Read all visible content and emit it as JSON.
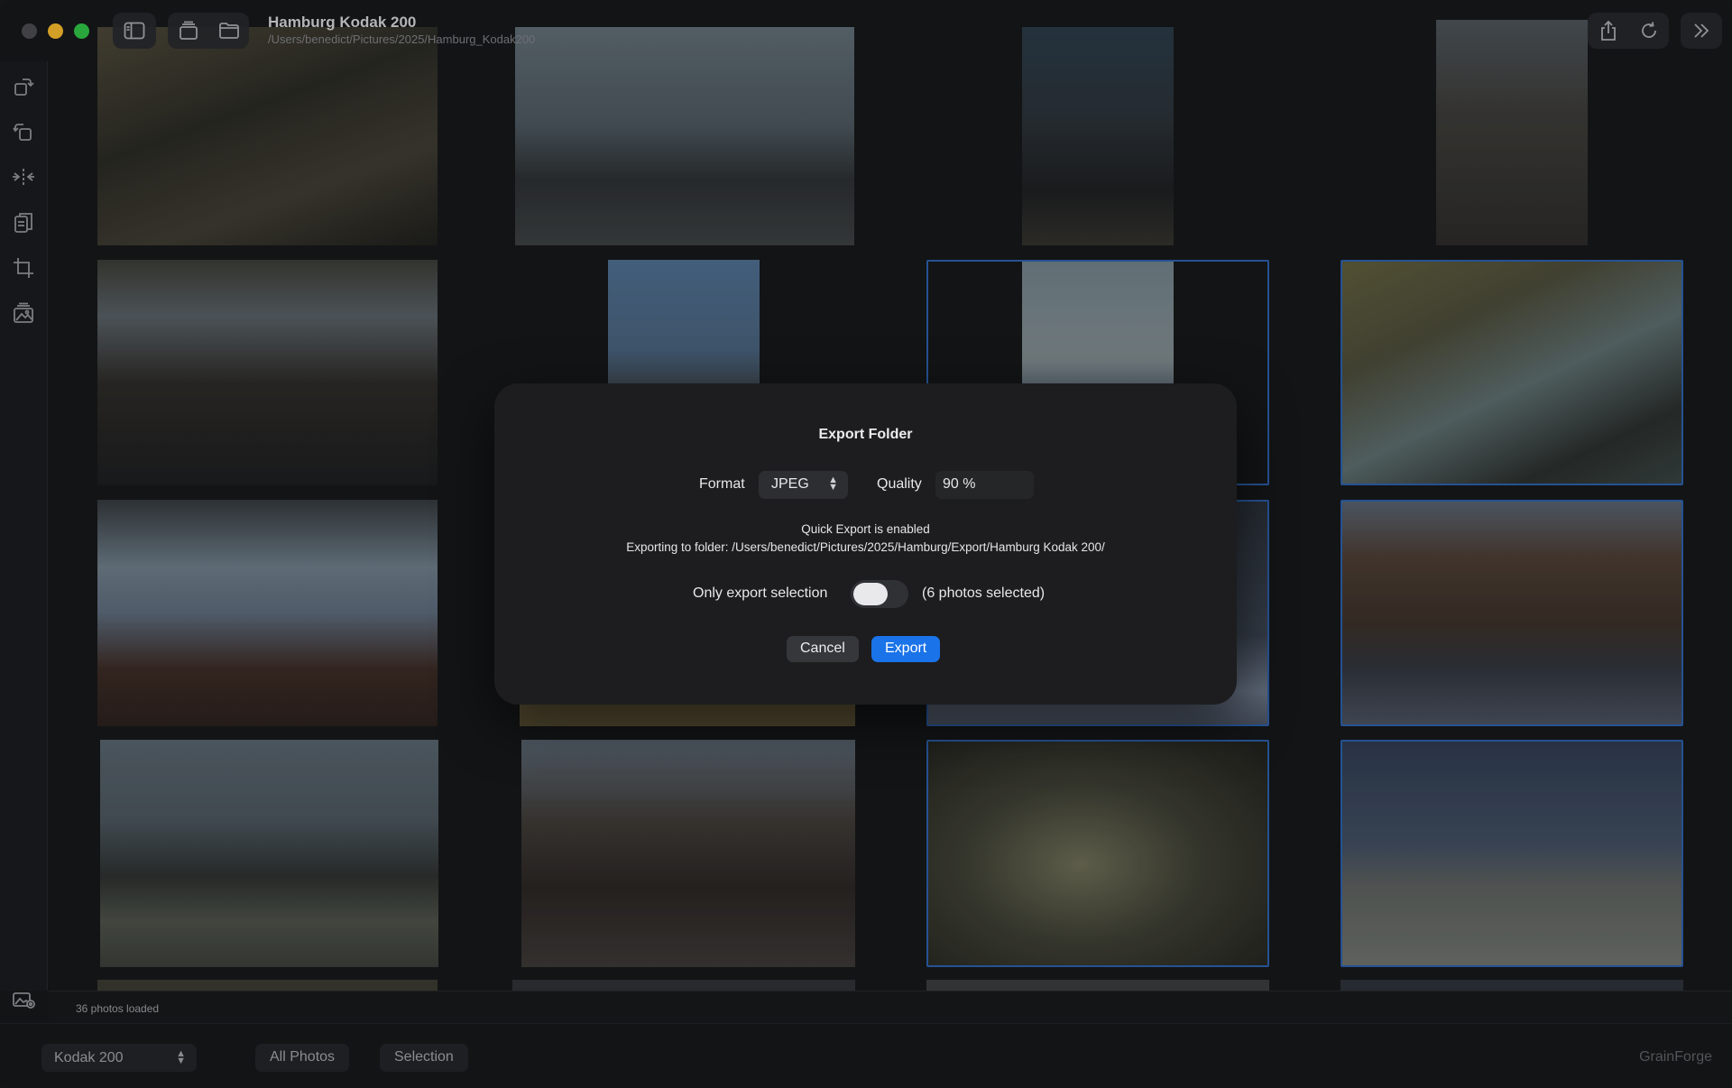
{
  "window": {
    "title": "Hamburg Kodak 200",
    "path": "/Users/benedict/Pictures/2025/Hamburg_Kodak200"
  },
  "toolbar": {
    "left_icons": [
      "sidebar-icon",
      "stack-icon",
      "folder-icon"
    ],
    "right_icons": [
      "share-icon",
      "refresh-icon",
      "forward-icon"
    ]
  },
  "tools": [
    "rotate-right-icon",
    "rotate-left-icon",
    "flip-icon",
    "copy-settings-icon",
    "crop-icon",
    "photo-library-icon"
  ],
  "status": {
    "loaded": "36 photos loaded"
  },
  "footer": {
    "preset": "Kodak 200",
    "all_photos": "All Photos",
    "selection": "Selection",
    "brand": "GrainForge"
  },
  "grid": {
    "selected_photo_count": 6
  },
  "dialog": {
    "title": "Export Folder",
    "format_label": "Format",
    "format_value": "JPEG",
    "quality_label": "Quality",
    "quality_value": "90 %",
    "quick_export": "Quick Export is enabled",
    "export_path": "Exporting to folder: /Users/benedict/Pictures/2025/Hamburg/Export/Hamburg Kodak 200/",
    "only_selection_label": "Only export selection",
    "only_selection_on": false,
    "selected_count": "(6 photos selected)",
    "cancel_label": "Cancel",
    "export_label": "Export"
  },
  "colors": {
    "accent": "#1a73e8",
    "selection_border": "#2b5ea8",
    "background": "#161719"
  }
}
